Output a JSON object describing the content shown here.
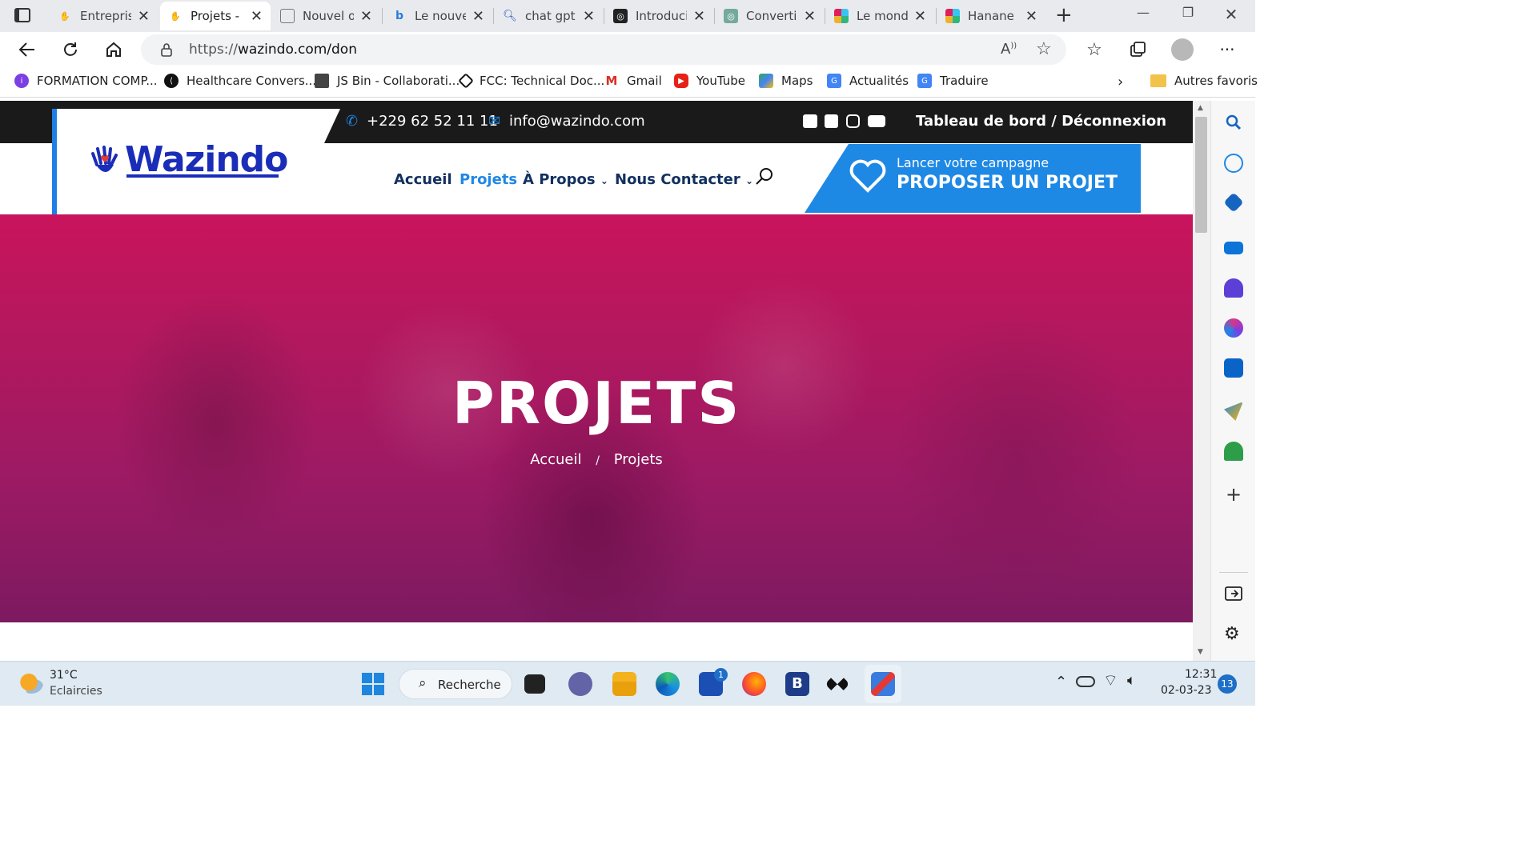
{
  "browser": {
    "tabs": [
      {
        "title": "Entrepris",
        "active": false
      },
      {
        "title": "Projets -",
        "active": true
      },
      {
        "title": "Nouvel o",
        "active": false
      },
      {
        "title": "Le nouve",
        "active": false
      },
      {
        "title": "chat gpt",
        "active": false
      },
      {
        "title": "Introduci",
        "active": false
      },
      {
        "title": "Converti",
        "active": false
      },
      {
        "title": "Le mond",
        "active": false
      },
      {
        "title": "Hanane l",
        "active": false
      }
    ],
    "url_prefix": "https://",
    "url_rest": "wazindo.com/don",
    "bookmarks": [
      "FORMATION COMP...",
      "Healthcare Convers...",
      "JS Bin - Collaborati...",
      "FCC: Technical Doc...",
      "Gmail",
      "YouTube",
      "Maps",
      "Actualités",
      "Traduire"
    ],
    "other_favorites": "Autres favoris"
  },
  "site": {
    "phone": "+229 62 52 11 11",
    "email": "info@wazindo.com",
    "account_link": "Tableau de bord / Déconnexion",
    "logo_text": "Wazindo",
    "menu": [
      "Accueil",
      "Projets",
      "À Propos",
      "Nous Contacter"
    ],
    "menu_active": "Projets",
    "cta_small": "Lancer votre campagne",
    "cta_big": "PROPOSER UN PROJET",
    "hero_title": "PROJETS",
    "breadcrumb_home": "Accueil",
    "breadcrumb_sep": "/",
    "breadcrumb_current": "Projets"
  },
  "taskbar": {
    "temperature": "31°C",
    "weather": "Eclaircies",
    "search": "Recherche",
    "time": "12:31",
    "date": "02-03-23",
    "notifications": "13",
    "store_badge": "1"
  },
  "colors": {
    "brand_blue": "#1a2db8",
    "cta_blue": "#1e88e5",
    "hero_magenta": "#c9145c",
    "topbar_dark": "#1a1a1a"
  }
}
